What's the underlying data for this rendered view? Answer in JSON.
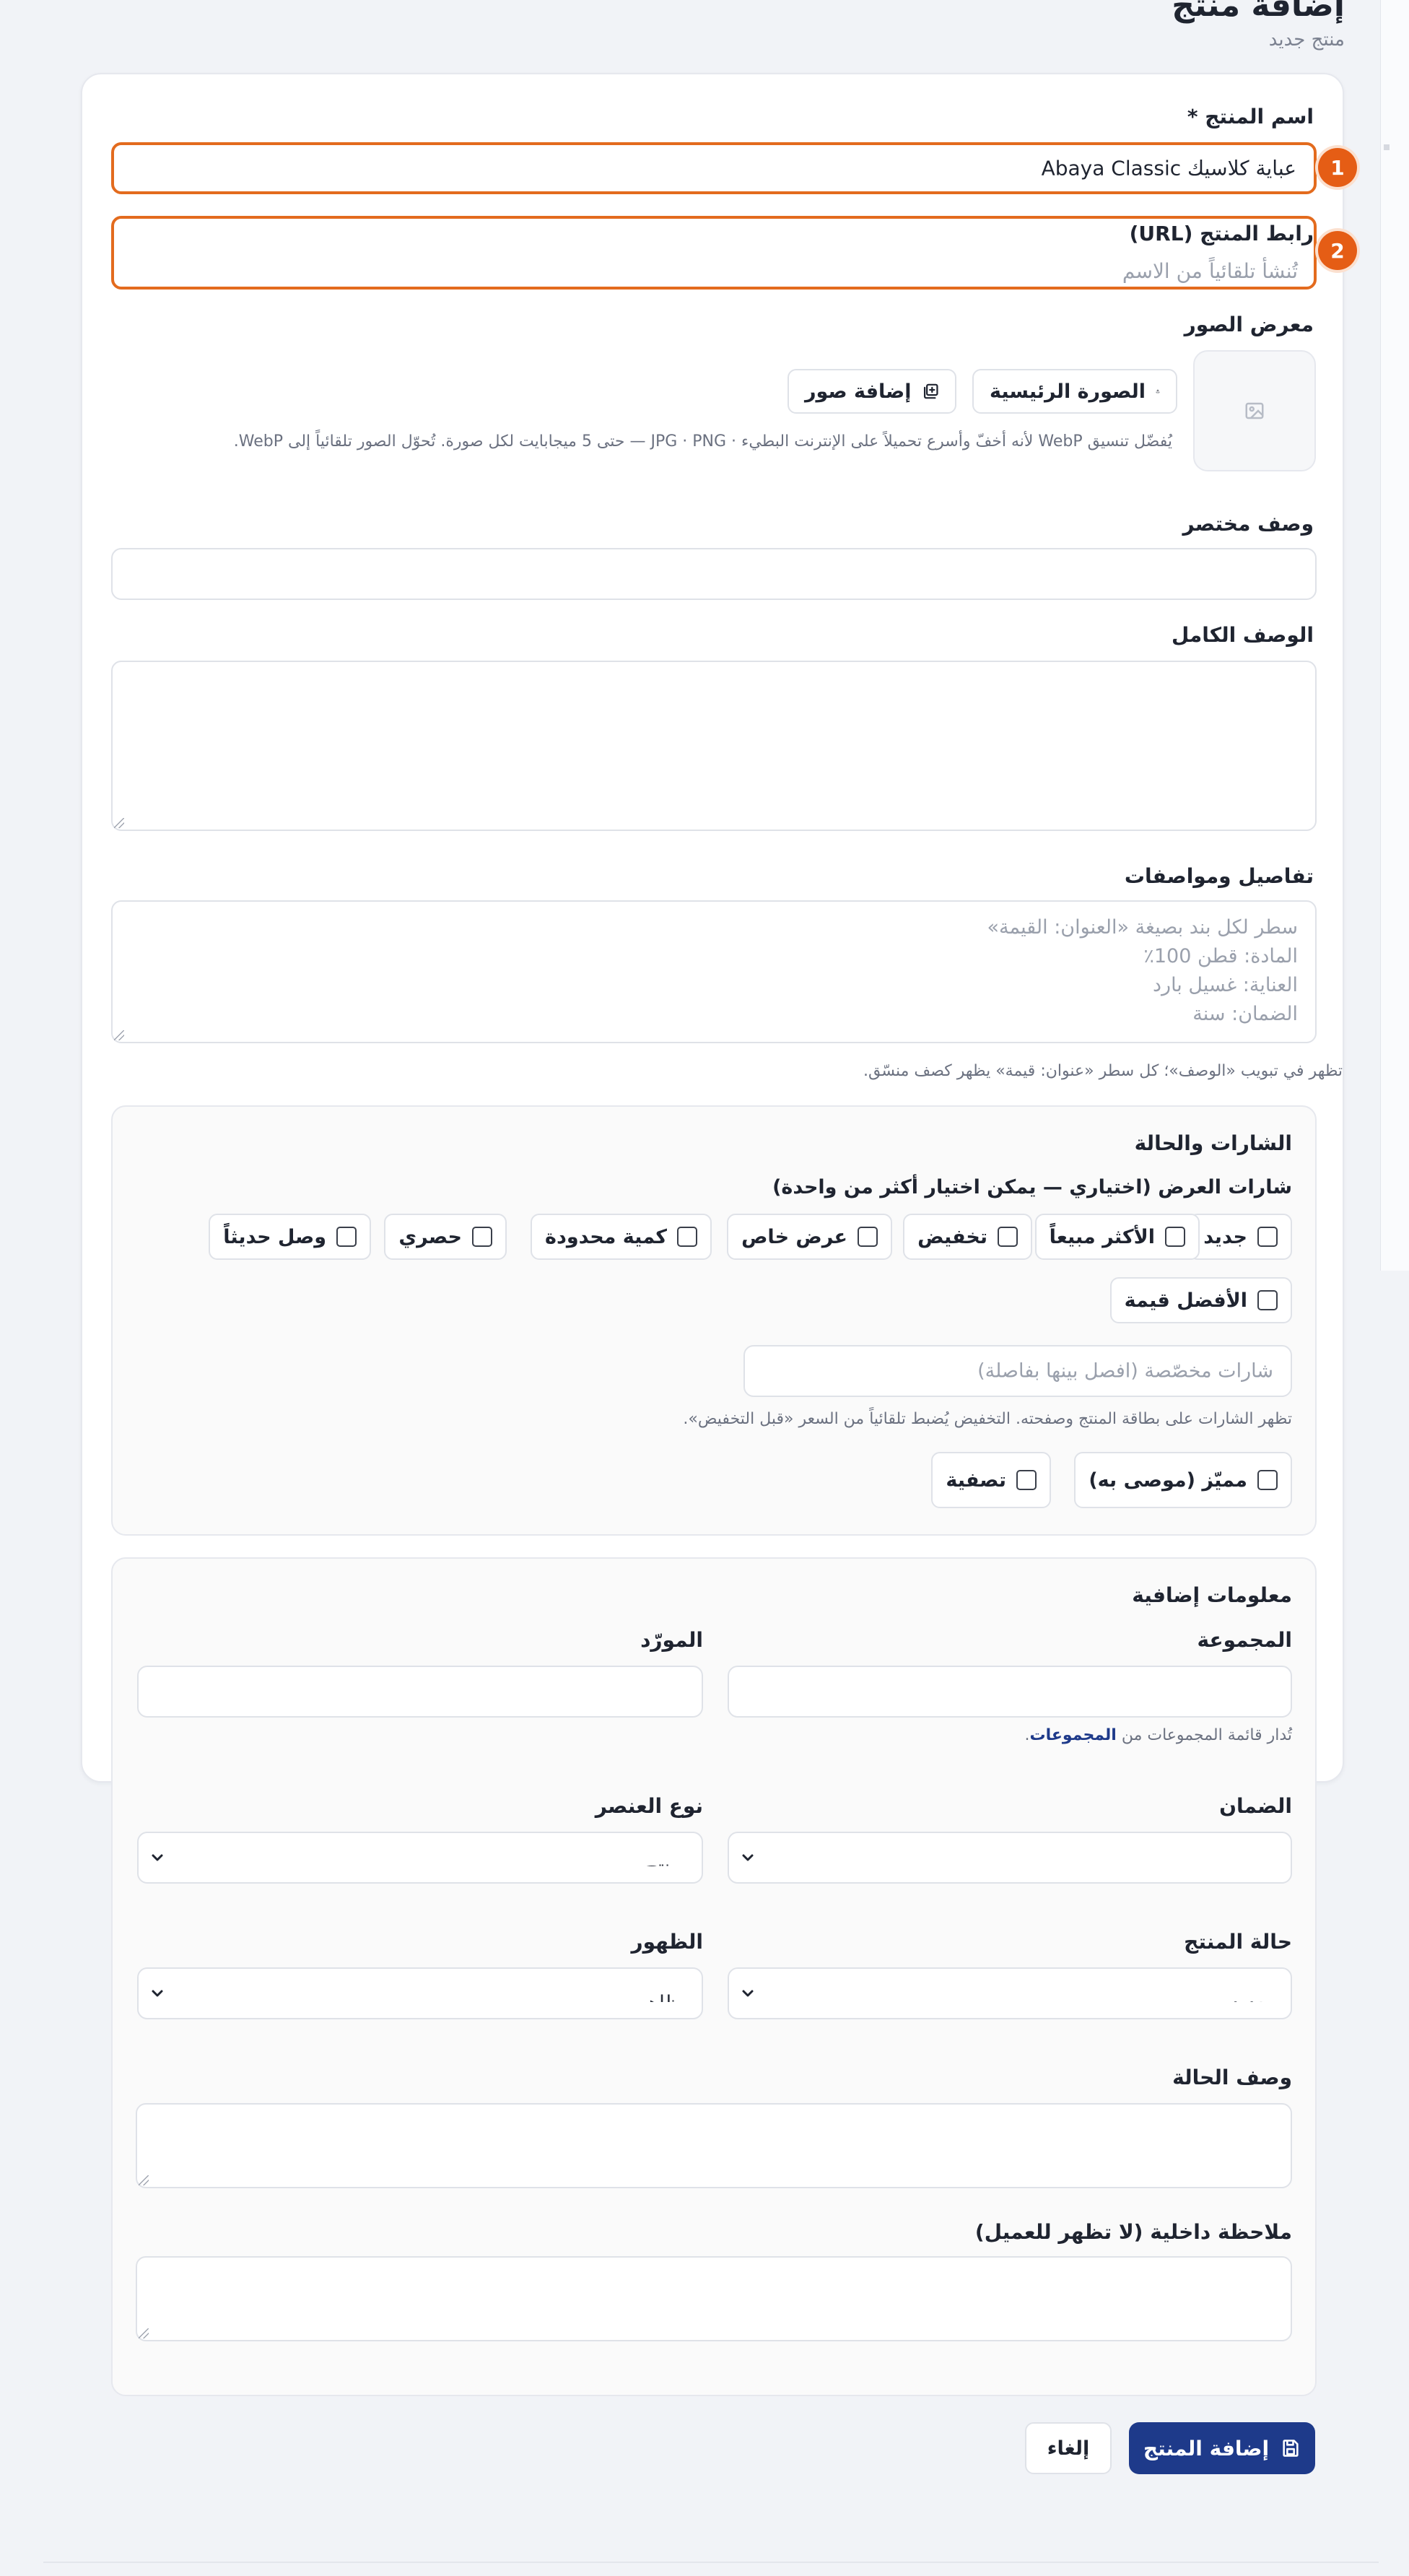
{
  "page": {
    "title": "إضافة منتج",
    "subtitle": "منتج جديد"
  },
  "form": {
    "product_name": {
      "label": "اسم المنتج *",
      "value": "عباية كلاسيك Abaya Classic",
      "marker": "1"
    },
    "product_url": {
      "label": "رابط المنتج (URL)",
      "placeholder": "تُنشأ تلقائياً من الاسم",
      "marker": "2"
    },
    "gallery": {
      "label": "معرض الصور",
      "main_image_button": "الصورة الرئيسية",
      "add_images_button": "إضافة صور",
      "help": "يُفضّل تنسيق WebP لأنه أخفّ وأسرع تحميلاً على الإنترنت البطيء · JPG · PNG — حتى 5 ميجابايت لكل صورة. تُحوّل الصور تلقائياً إلى WebP."
    },
    "short_description": {
      "label": "وصف مختصر"
    },
    "full_description": {
      "label": "الوصف الكامل"
    },
    "specs": {
      "label": "تفاصيل ومواصفات",
      "placeholder_lines": [
        "سطر لكل بند بصيغة «العنوان: القيمة»",
        "المادة: قطن 100٪",
        "العناية: غسيل بارد",
        "الضمان: سنة"
      ],
      "help": "تظهر في تبويب «الوصف»؛ كل سطر «عنوان: قيمة» يظهر كصف منسّق."
    }
  },
  "badges": {
    "title": "الشارات والحالة",
    "subtitle": "شارات العرض (اختياري — يمكن اختيار أكثر من واحدة)",
    "options": [
      "جديد",
      "الأكثر مبيعاً",
      "تخفيض",
      "عرض خاص",
      "كمية محدودة",
      "حصري",
      "وصل حديثاً",
      "الأفضل قيمة"
    ],
    "custom_placeholder": "شارات مخصّصة (افصل بينها بفاصلة)",
    "help": "تظهر الشارات على بطاقة المنتج وصفحته. التخفيض يُضبط تلقائياً من السعر «قبل التخفيض».",
    "featured": "مميّز (موصى به)",
    "clearance": "تصفية"
  },
  "extra": {
    "title": "معلومات إضافية",
    "collection_label": "المجموعة",
    "supplier_label": "المورّد",
    "collections_help_prefix": "تُدار قائمة المجموعات من",
    "collections_link": "المجموعات",
    "collections_help_suffix": ".",
    "warranty_label": "الضمان",
    "warranty_value": "—",
    "item_type_label": "نوع العنصر",
    "item_type_value": "منتج",
    "condition_label": "حالة المنتج",
    "condition_value": "جديد",
    "visibility_label": "الظهور",
    "visibility_value": "ظاهر",
    "condition_desc_label": "وصف الحالة",
    "internal_note_label": "ملاحظة داخلية (لا تظهر للعميل)"
  },
  "actions": {
    "submit": "إضافة المنتج",
    "cancel": "إلغاء"
  },
  "colors": {
    "highlight": "#e36b1e",
    "marker": "#e55d15",
    "primary": "#1e3a8a"
  }
}
